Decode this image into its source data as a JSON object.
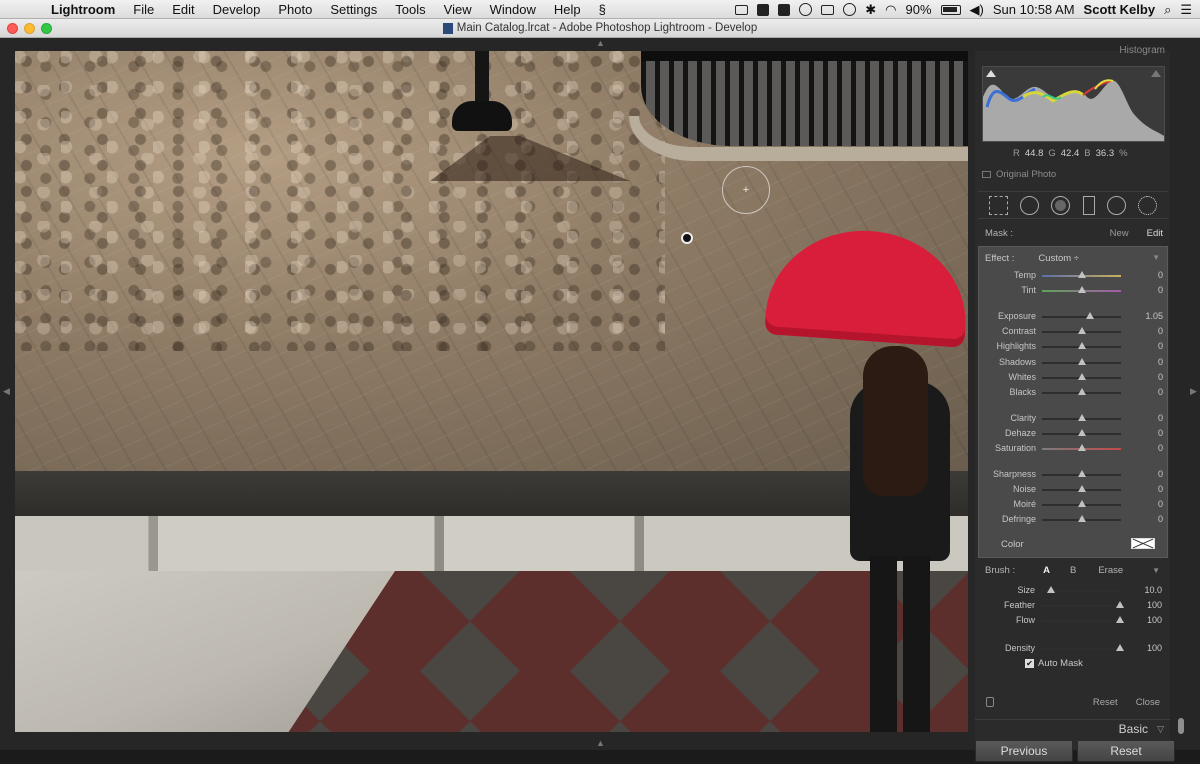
{
  "menubar": {
    "app_name": "Lightroom",
    "menus": [
      "File",
      "Edit",
      "Develop",
      "Photo",
      "Settings",
      "Tools",
      "View",
      "Window",
      "Help"
    ],
    "battery": "90%",
    "clock": "Sun 10:58 AM",
    "user": "Scott Kelby"
  },
  "window": {
    "title": "Main Catalog.lrcat - Adobe Photoshop Lightroom - Develop"
  },
  "histogram": {
    "title": "Histogram",
    "r_label": "R",
    "r_value": "44.8",
    "g_label": "G",
    "g_value": "42.4",
    "b_label": "B",
    "b_value": "36.3",
    "unit": "%",
    "original_photo": "Original Photo"
  },
  "mask": {
    "label": "Mask :",
    "new": "New",
    "edit": "Edit"
  },
  "effect": {
    "label": "Effect :",
    "preset": "Custom ÷"
  },
  "sliders": [
    {
      "label": "Temp",
      "value": "0",
      "position": 0.5,
      "track": "temp"
    },
    {
      "label": "Tint",
      "value": "0",
      "position": 0.5,
      "track": "tint"
    },
    {
      "label": "Exposure",
      "value": "1.05",
      "position": 0.61,
      "track": ""
    },
    {
      "label": "Contrast",
      "value": "0",
      "position": 0.5,
      "track": ""
    },
    {
      "label": "Highlights",
      "value": "0",
      "position": 0.5,
      "track": ""
    },
    {
      "label": "Shadows",
      "value": "0",
      "position": 0.5,
      "track": ""
    },
    {
      "label": "Whites",
      "value": "0",
      "position": 0.5,
      "track": ""
    },
    {
      "label": "Blacks",
      "value": "0",
      "position": 0.5,
      "track": ""
    },
    {
      "label": "Clarity",
      "value": "0",
      "position": 0.5,
      "track": ""
    },
    {
      "label": "Dehaze",
      "value": "0",
      "position": 0.5,
      "track": ""
    },
    {
      "label": "Saturation",
      "value": "0",
      "position": 0.5,
      "track": "sat"
    },
    {
      "label": "Sharpness",
      "value": "0",
      "position": 0.5,
      "track": ""
    },
    {
      "label": "Noise",
      "value": "0",
      "position": 0.5,
      "track": ""
    },
    {
      "label": "Moiré",
      "value": "0",
      "position": 0.5,
      "track": ""
    },
    {
      "label": "Defringe",
      "value": "0",
      "position": 0.5,
      "track": ""
    }
  ],
  "color": {
    "label": "Color"
  },
  "brush": {
    "label": "Brush :",
    "a": "A",
    "b": "B",
    "erase": "Erase",
    "sliders": [
      {
        "label": "Size",
        "value": "10.0",
        "position": 0.13
      },
      {
        "label": "Feather",
        "value": "100",
        "position": 1.0
      },
      {
        "label": "Flow",
        "value": "100",
        "position": 1.0
      }
    ],
    "auto_mask": "Auto Mask",
    "auto_mask_checked": true,
    "density": {
      "label": "Density",
      "value": "100",
      "position": 1.0
    }
  },
  "panel_footer": {
    "reset": "Reset",
    "close": "Close"
  },
  "basic": {
    "label": "Basic"
  },
  "buttons": {
    "previous": "Previous",
    "reset": "Reset"
  }
}
